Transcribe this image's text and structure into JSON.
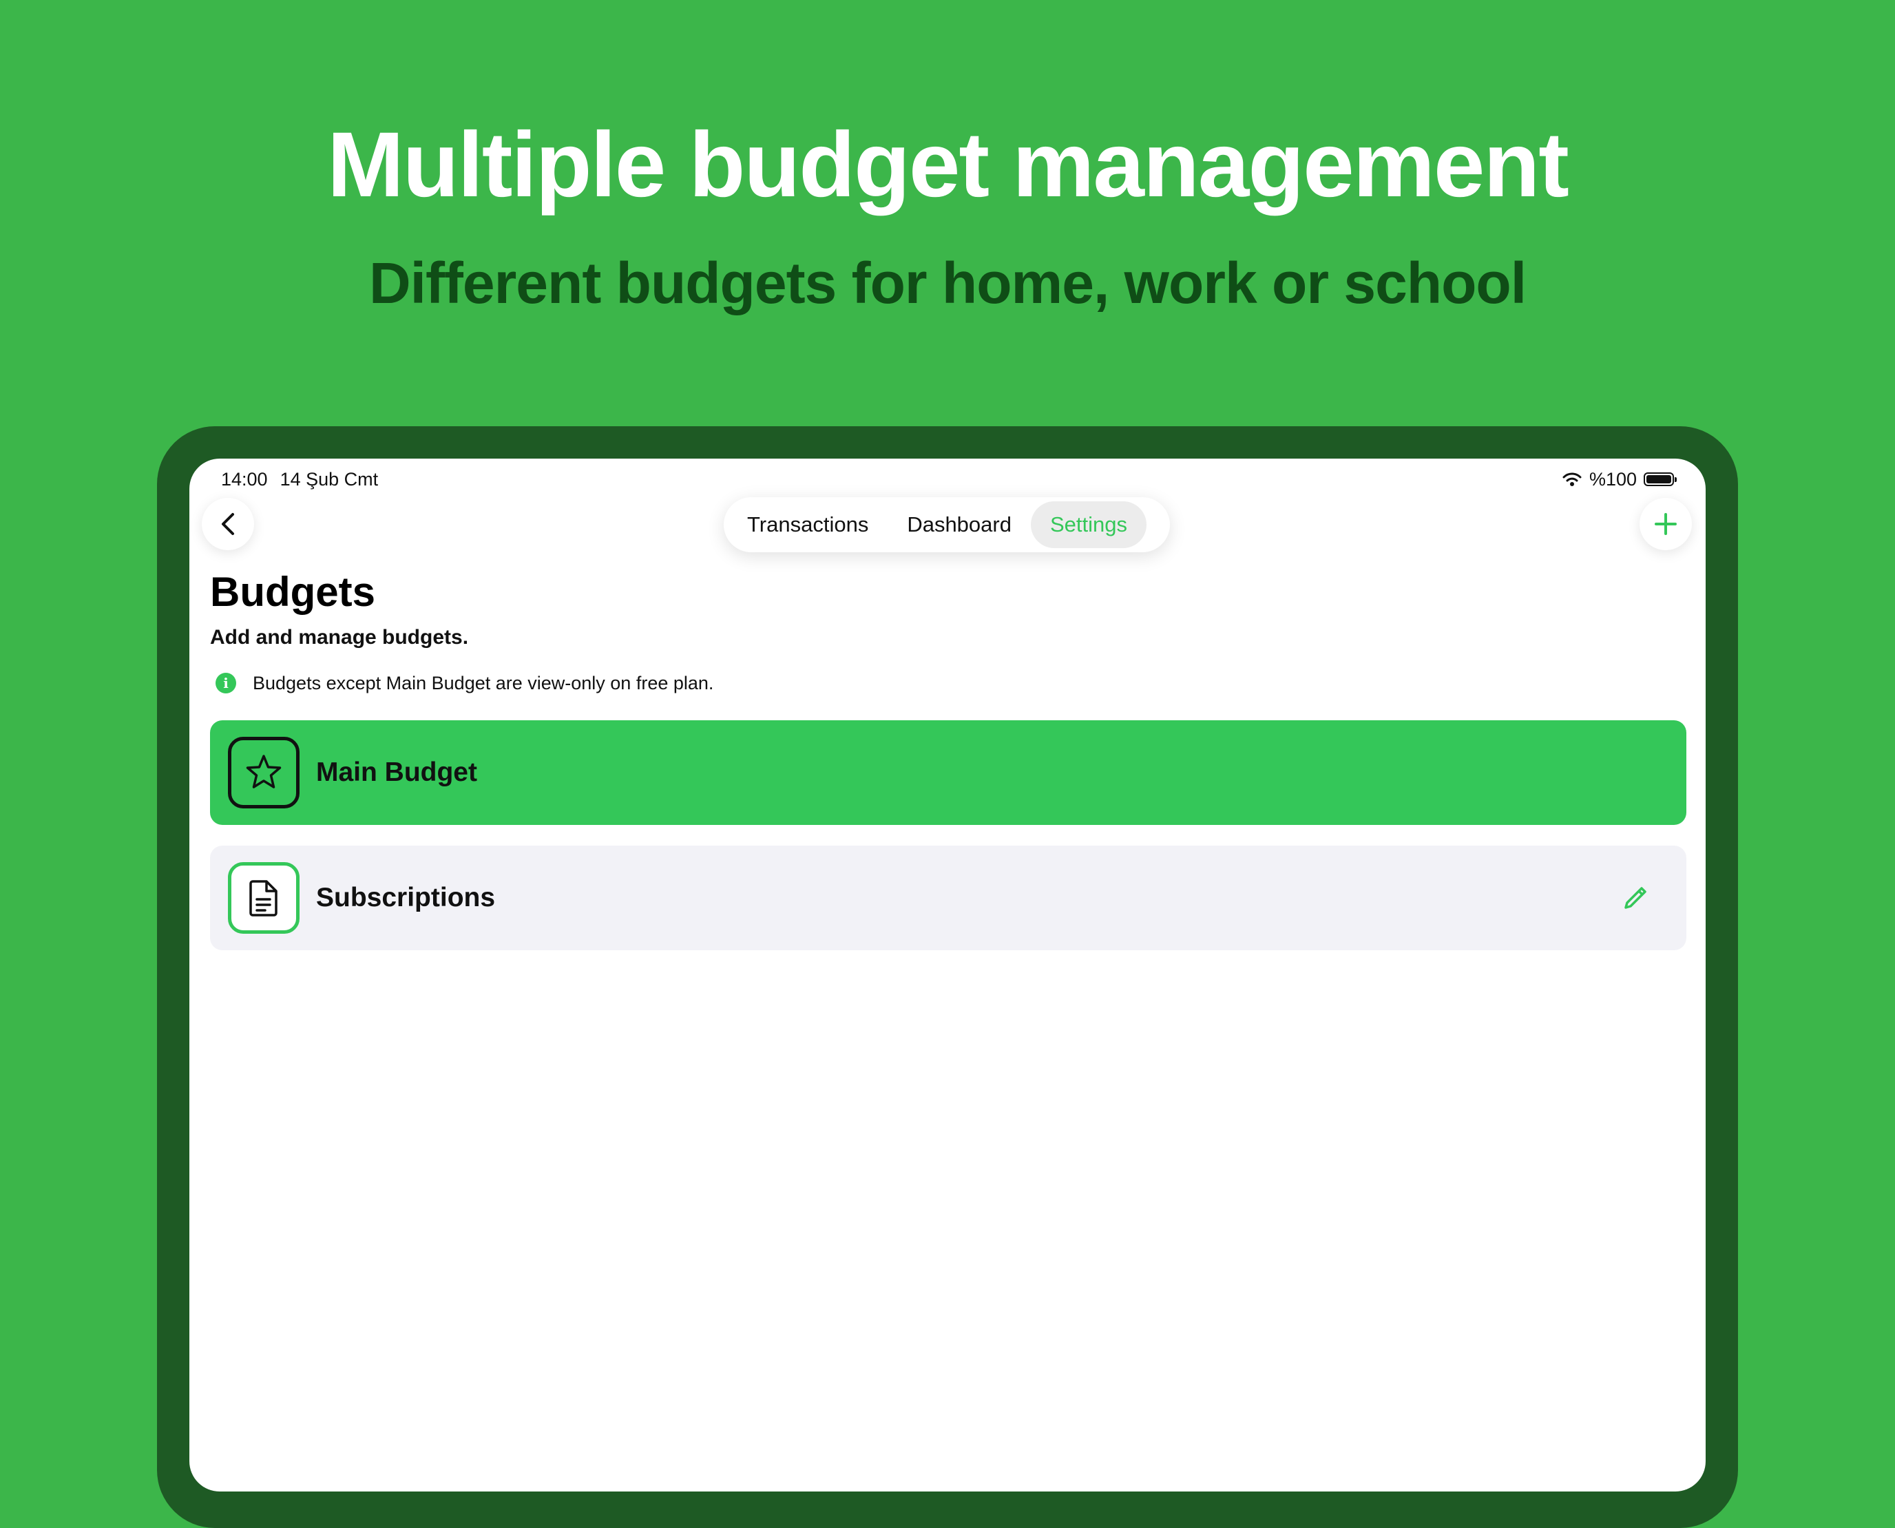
{
  "hero": {
    "title": "Multiple budget management",
    "subtitle": "Different budgets for home, work or school"
  },
  "status_bar": {
    "time": "14:00",
    "date": "14 Şub Cmt",
    "battery": "%100"
  },
  "nav": {
    "back_icon": "chevron-left-icon",
    "add_icon": "plus-icon",
    "tabs": [
      {
        "label": "Transactions",
        "active": false
      },
      {
        "label": "Dashboard",
        "active": false
      },
      {
        "label": "Settings",
        "active": true
      }
    ]
  },
  "page": {
    "title": "Budgets",
    "description": "Add and manage budgets.",
    "notice": "Budgets except Main Budget are view-only on free plan.",
    "notice_icon": "info-icon"
  },
  "budgets": [
    {
      "name": "Main Budget",
      "icon": "star-icon",
      "selected": true
    },
    {
      "name": "Subscriptions",
      "icon": "document-icon",
      "selected": false,
      "action_icon": "pencil-icon"
    }
  ],
  "colors": {
    "background": "#3cb64a",
    "device_frame": "#1e5a24",
    "accent": "#34c759",
    "subtitle": "#0f4d16",
    "row_background": "#f2f2f7"
  }
}
